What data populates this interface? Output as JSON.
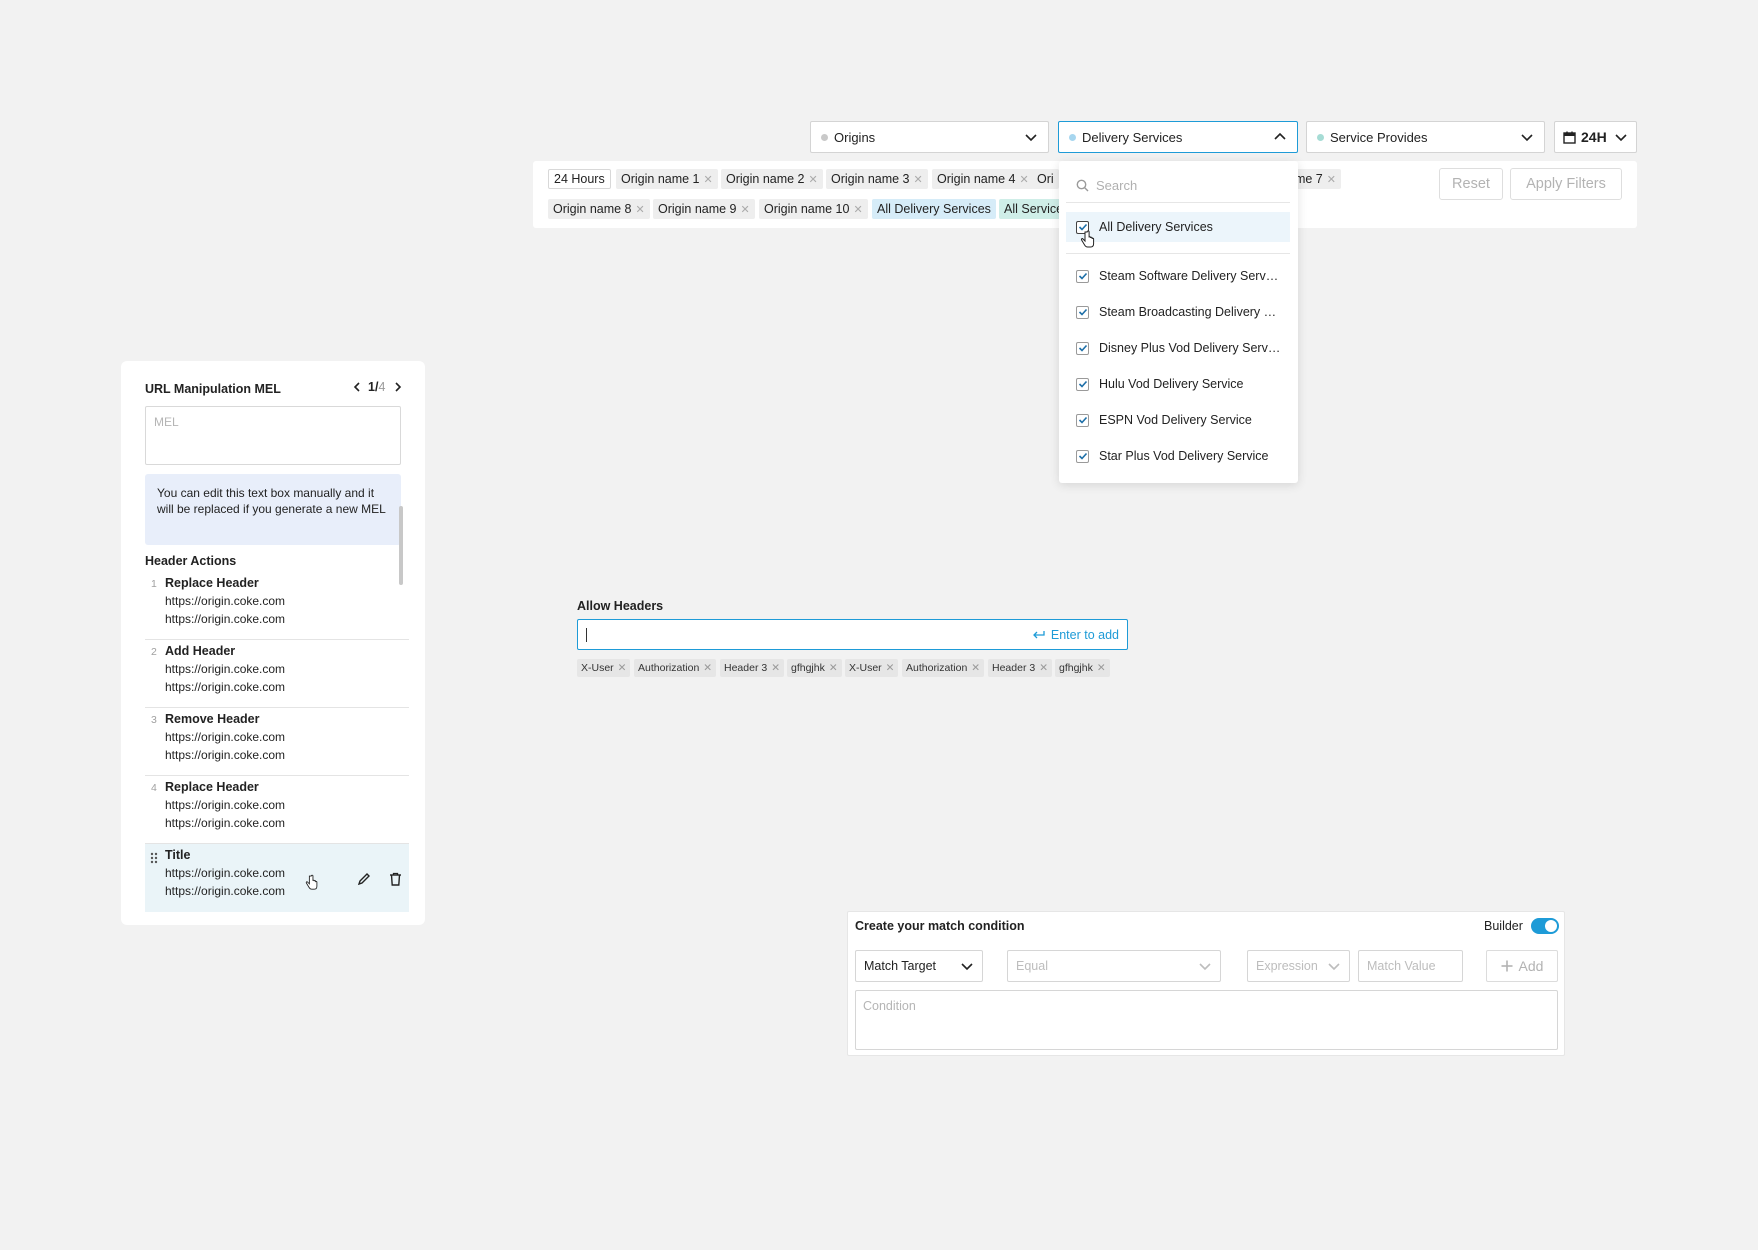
{
  "filters": {
    "origins": "Origins",
    "delivery": "Delivery Services",
    "service": "Service Provides",
    "time": "24H"
  },
  "chips": {
    "row1": [
      "24 Hours",
      "Origin name 1",
      "Origin name 2",
      "Origin name 3",
      "Origin name 4",
      "Ori",
      "ame 7"
    ],
    "row2": [
      "Origin name 8",
      "Origin name 9",
      "Origin name 10",
      "All Delivery Services",
      "All Service"
    ],
    "reset": "Reset",
    "apply": "Apply Filters"
  },
  "dropdown": {
    "search_placeholder": "Search",
    "all": "All Delivery Services",
    "items": [
      "Steam Software Delivery Service",
      "Steam Broadcasting Delivery Service",
      "Disney Plus Vod Delivery Service",
      "Hulu Vod Delivery Service",
      "ESPN Vod Delivery Service",
      "Star Plus Vod Delivery Service"
    ]
  },
  "panel": {
    "title": "URL Manipulation MEL",
    "page_current": "1",
    "page_sep": "/",
    "page_total": "4",
    "mel_placeholder": "MEL",
    "info": "You can edit this text box manually and it will be replaced if you generate a new MEL",
    "section": "Header Actions",
    "rows": [
      {
        "num": "1",
        "title": "Replace Header",
        "u1": "https://origin.coke.com",
        "u2": "https://origin.coke.com"
      },
      {
        "num": "2",
        "title": "Add Header",
        "u1": "https://origin.coke.com",
        "u2": "https://origin.coke.com"
      },
      {
        "num": "3",
        "title": "Remove Header",
        "u1": "https://origin.coke.com",
        "u2": "https://origin.coke.com"
      },
      {
        "num": "4",
        "title": "Replace Header",
        "u1": "https://origin.coke.com",
        "u2": "https://origin.coke.com"
      },
      {
        "num": "",
        "title": "Title",
        "u1": "https://origin.coke.com",
        "u2": "https://origin.coke.com"
      }
    ]
  },
  "allow_headers": {
    "label": "Allow Headers",
    "value": "",
    "hint": "Enter to add",
    "tags": [
      "X-User",
      "Authorization",
      "Header 3",
      "gfhgjhk",
      "X-User",
      "Authorization",
      "Header 3",
      "gfhgjhk"
    ]
  },
  "match": {
    "title": "Create your match condition",
    "builder": "Builder",
    "target": "Match Target",
    "operator_placeholder": "Equal",
    "expression_placeholder": "Expression",
    "value_placeholder": "Match Value",
    "add": "Add",
    "condition_placeholder": "Condition"
  }
}
